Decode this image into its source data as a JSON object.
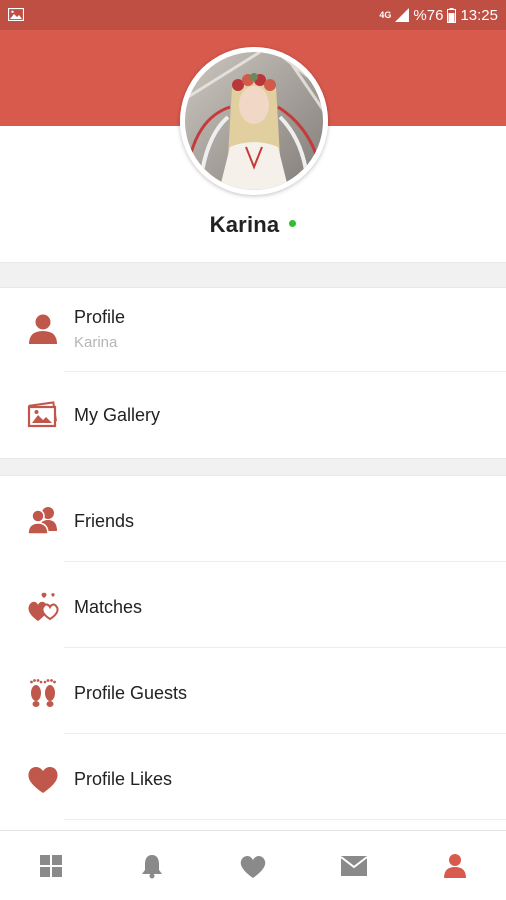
{
  "status_bar": {
    "network": "4G",
    "battery": "%76",
    "time": "13:25"
  },
  "profile": {
    "name": "Karina",
    "online": true
  },
  "menu": {
    "profile": {
      "label": "Profile",
      "sublabel": "Karina",
      "icon": "person-icon"
    },
    "gallery": {
      "label": "My Gallery",
      "icon": "gallery-icon"
    },
    "friends": {
      "label": "Friends",
      "icon": "friends-icon"
    },
    "matches": {
      "label": "Matches",
      "icon": "matches-hearts-icon"
    },
    "guests": {
      "label": "Profile Guests",
      "icon": "footprints-icon"
    },
    "likes": {
      "label": "Profile Likes",
      "icon": "heart-icon"
    }
  },
  "bottom_nav": {
    "items": [
      "grid-icon",
      "bell-icon",
      "heart-icon",
      "envelope-icon",
      "person-icon"
    ],
    "active": "person-icon"
  },
  "colors": {
    "brand": "#d85a4d",
    "status_bar": "#c04f43",
    "icon_red": "#c0574b",
    "nav_inactive": "#8a8a8a",
    "online": "#2ec02e"
  }
}
